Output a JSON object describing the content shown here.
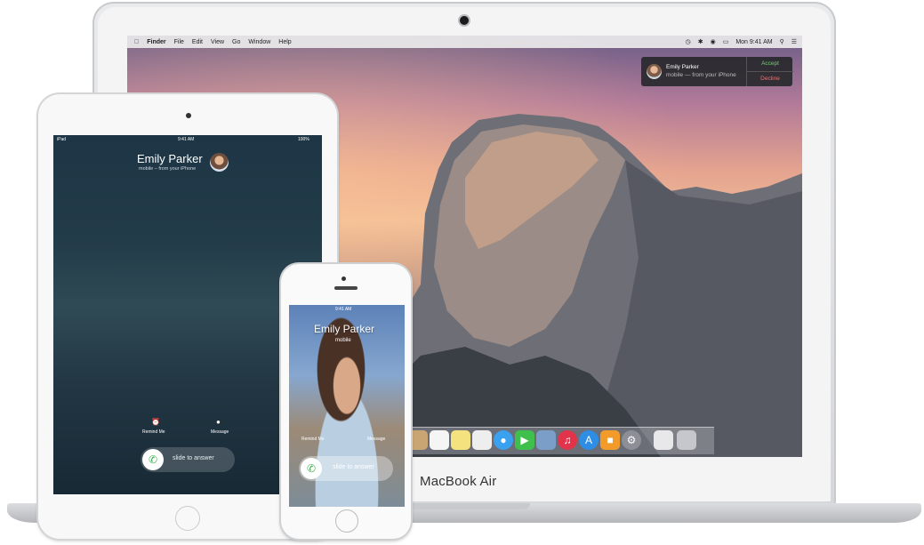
{
  "macbook": {
    "brand_label": "MacBook Air",
    "menubar": {
      "apple_icon": "apple-icon",
      "app": "Finder",
      "menus": [
        "File",
        "Edit",
        "View",
        "Go",
        "Window",
        "Help"
      ],
      "clock": "Mon 9:41 AM",
      "status_icons": [
        "time-machine-icon",
        "bluetooth-icon",
        "wifi-icon",
        "battery-icon",
        "search-icon",
        "list-icon"
      ]
    },
    "notification": {
      "caller": "Emily Parker",
      "subtitle": "mobile — from your iPhone",
      "accept": "Accept",
      "decline": "Decline"
    },
    "dock_icons": [
      "contacts-icon",
      "calendar-icon",
      "notes-icon",
      "reminders-icon",
      "maps-icon",
      "messages-icon",
      "facetime-icon",
      "photos-icon",
      "itunes-icon",
      "app-store-icon",
      "ibooks-icon",
      "system-preferences-icon",
      "preview-icon",
      "trash-icon"
    ]
  },
  "ipad": {
    "status_left": "iPad",
    "status_time": "9:41 AM",
    "status_right": "100%",
    "caller": "Emily Parker",
    "subtitle": "mobile – from your iPhone",
    "remind": "Remind Me",
    "message": "Message",
    "slide": "slide to answer"
  },
  "iphone": {
    "status_time": "9:41 AM",
    "caller": "Emily Parker",
    "subtitle": "mobile",
    "remind": "Remind Me",
    "message": "Message",
    "slide": "slide to answer"
  }
}
